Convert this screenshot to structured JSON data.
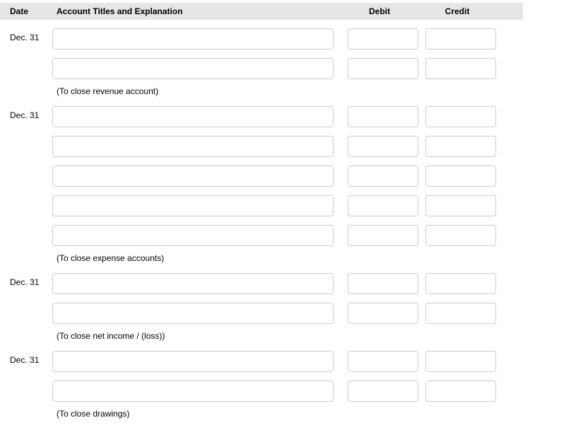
{
  "header": {
    "date": "Date",
    "acct": "Account Titles and Explanation",
    "debit": "Debit",
    "credit": "Credit"
  },
  "entries": [
    {
      "date": "Dec. 31",
      "rows": [
        {
          "acct": "",
          "debit": "",
          "credit": ""
        },
        {
          "acct": "",
          "debit": "",
          "credit": ""
        }
      ],
      "explain": "(To close revenue account)"
    },
    {
      "date": "Dec. 31",
      "rows": [
        {
          "acct": "",
          "debit": "",
          "credit": ""
        },
        {
          "acct": "",
          "debit": "",
          "credit": ""
        },
        {
          "acct": "",
          "debit": "",
          "credit": ""
        },
        {
          "acct": "",
          "debit": "",
          "credit": ""
        },
        {
          "acct": "",
          "debit": "",
          "credit": ""
        }
      ],
      "explain": "(To close expense accounts)"
    },
    {
      "date": "Dec. 31",
      "rows": [
        {
          "acct": "",
          "debit": "",
          "credit": ""
        },
        {
          "acct": "",
          "debit": "",
          "credit": ""
        }
      ],
      "explain": "(To close net income / (loss))"
    },
    {
      "date": "Dec. 31",
      "rows": [
        {
          "acct": "",
          "debit": "",
          "credit": ""
        },
        {
          "acct": "",
          "debit": "",
          "credit": ""
        }
      ],
      "explain": "(To close drawings)"
    }
  ]
}
